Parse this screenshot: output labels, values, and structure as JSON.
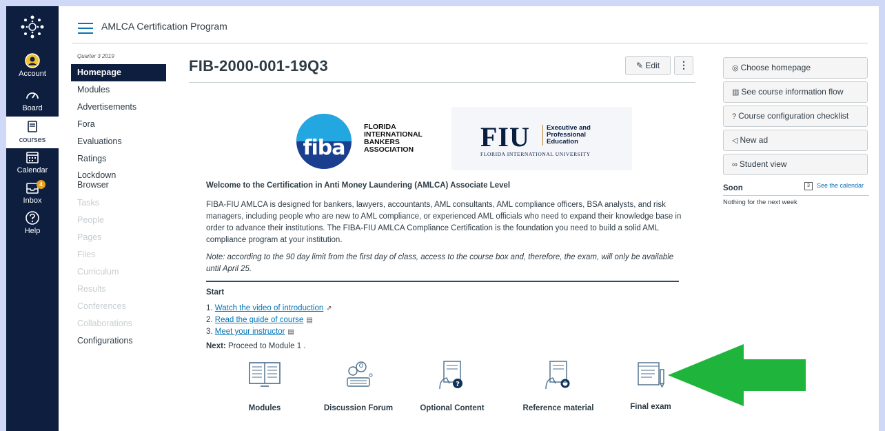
{
  "global_nav": {
    "items": [
      {
        "label": "Account",
        "icon": "account-icon"
      },
      {
        "label": "Board",
        "icon": "dashboard-icon"
      },
      {
        "label": "courses",
        "icon": "courses-icon"
      },
      {
        "label": "Calendar",
        "icon": "calendar-icon"
      },
      {
        "label": "Inbox",
        "icon": "inbox-icon"
      },
      {
        "label": "Help",
        "icon": "help-icon"
      }
    ],
    "inbox_badge": "4",
    "active": "courses"
  },
  "breadcrumb": {
    "title": "AMLCA Certification Program"
  },
  "course_nav": {
    "term": "Quarter 3 2019",
    "items": [
      {
        "label": "Homepage",
        "state": "active"
      },
      {
        "label": "Modules",
        "state": "normal"
      },
      {
        "label": "Advertisements",
        "state": "normal"
      },
      {
        "label": "Fora",
        "state": "normal"
      },
      {
        "label": "Evaluations",
        "state": "normal"
      },
      {
        "label": "Ratings",
        "state": "normal"
      },
      {
        "label": "Lockdown Browser",
        "state": "normal"
      },
      {
        "label": "Tasks",
        "state": "disabled"
      },
      {
        "label": "People",
        "state": "disabled"
      },
      {
        "label": "Pages",
        "state": "disabled"
      },
      {
        "label": "Files",
        "state": "disabled"
      },
      {
        "label": "Curriculum",
        "state": "disabled"
      },
      {
        "label": "Results",
        "state": "disabled"
      },
      {
        "label": "Conferences",
        "state": "disabled"
      },
      {
        "label": "Collaborations",
        "state": "disabled"
      },
      {
        "label": "Configurations",
        "state": "normal"
      }
    ]
  },
  "page": {
    "title": "FIB-2000-001-19Q3",
    "edit_label": "Edit",
    "more_label": "⋮"
  },
  "logos": {
    "fiba_word": "fiba",
    "fiba_lines": [
      "FLORIDA",
      "INTERNATIONAL",
      "BANKERS",
      "ASSOCIATION"
    ],
    "fiu_word": "FIU",
    "fiu_sub": [
      "Executive and",
      "Professional",
      "Education"
    ],
    "fiu_univ": "FLORIDA INTERNATIONAL UNIVERSITY"
  },
  "content": {
    "welcome": "Welcome to the Certification in Anti Money Laundering (AMLCA) Associate Level",
    "paragraph": "FIBA-FIU AMLCA is designed for bankers, lawyers, accountants, AML consultants, AML compliance officers, BSA analysts, and risk managers, including people who are new to AML compliance, or experienced AML officials who need to expand their knowledge base in order to advance their institutions. The FIBA-FIU AMLCA Compliance Certification is the foundation you need to build a solid AML compliance program at your institution.",
    "note": "Note: according to the 90 day limit from the first day of class, access to the course box and, therefore, the exam, will only be available until April 25.",
    "start_heading": "Start",
    "steps": [
      {
        "num": "1.",
        "label": "Watch the video of introduction",
        "icon": "external-link-icon",
        "glyph": "⇗"
      },
      {
        "num": "2.",
        "label": "Read the guide of course",
        "icon": "document-icon",
        "glyph": "▤"
      },
      {
        "num": "3.",
        "label": "Meet your instructor",
        "icon": "document-icon",
        "glyph": "▤"
      }
    ],
    "next_label": "Next:",
    "next_text": "Proceed to Module 1 ."
  },
  "tiles": [
    {
      "label": "Modules",
      "icon": "book-icon"
    },
    {
      "label": "Discussion Forum",
      "icon": "discussion-icon"
    },
    {
      "label": "Optional Content",
      "icon": "optional-content-icon"
    },
    {
      "label": "Reference material",
      "icon": "reference-icon"
    },
    {
      "label": "Final exam",
      "icon": "exam-icon"
    }
  ],
  "annotation": {
    "arrow_color": "#1fb53d",
    "arrow_icon": "left-arrow-icon"
  },
  "sidebar": {
    "buttons": [
      {
        "label": "Choose homepage",
        "icon": "target-icon",
        "glyph": "◎"
      },
      {
        "label": "See course information flow",
        "icon": "chart-icon",
        "glyph": "▥"
      },
      {
        "label": "Course configuration checklist",
        "icon": "question-icon",
        "glyph": "?"
      },
      {
        "label": "New ad",
        "icon": "megaphone-icon",
        "glyph": "◁"
      },
      {
        "label": "Student view",
        "icon": "glasses-icon",
        "glyph": "∞"
      }
    ],
    "soon_label": "Soon",
    "calendar_day": "3",
    "see_calendar": "See the calendar",
    "nothing": "Nothing for the next week"
  },
  "colors": {
    "nav_bg": "#0d1e3f",
    "link": "#0374b5",
    "text": "#2d3b45",
    "page_bg": "#cfd8f7"
  }
}
